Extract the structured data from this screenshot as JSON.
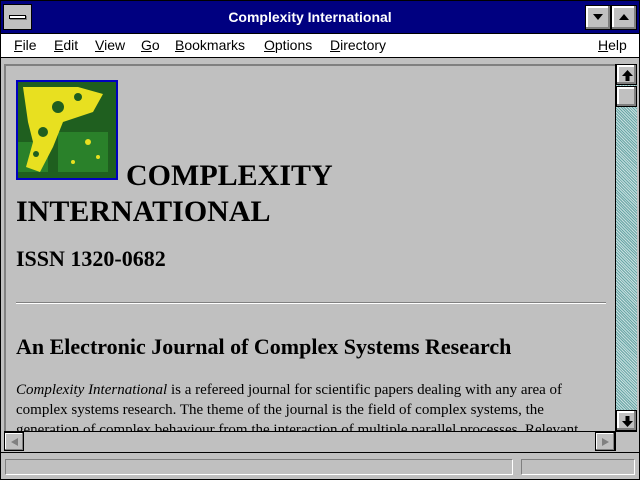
{
  "window": {
    "title": "Complexity International"
  },
  "menu": {
    "items": [
      {
        "label": "File",
        "underline": "F"
      },
      {
        "label": "Edit",
        "underline": "E"
      },
      {
        "label": "View",
        "underline": "V"
      },
      {
        "label": "Go",
        "underline": "G"
      },
      {
        "label": "Bookmarks",
        "underline": "B"
      },
      {
        "label": "Options",
        "underline": "O"
      },
      {
        "label": "Directory",
        "underline": "D"
      },
      {
        "label": "Help",
        "underline": "H"
      }
    ]
  },
  "page": {
    "title_line1": "COMPLEXITY",
    "title_line2": "INTERNATIONAL",
    "issn": "ISSN 1320-0682",
    "subtitle": "An Electronic Journal of Complex Systems Research",
    "para_italic": "Complexity International",
    "para_rest": " is a refereed journal for scientific papers dealing with any area of complex systems research. The theme of the journal is the field of complex systems, the generation of complex behaviour from the interaction of multiple parallel processes. Relevant topics include"
  },
  "icons": {
    "system_menu": "system-menu-icon",
    "minimize": "minimize-icon",
    "maximize": "maximize-icon",
    "scroll_up": "arrow-up-icon",
    "scroll_down": "arrow-down-icon",
    "scroll_left": "arrow-left-icon",
    "scroll_right": "arrow-right-icon",
    "logo": "journal-logo"
  },
  "status": {
    "text": "",
    "progress": 0
  },
  "colors": {
    "titlebar": "#000080",
    "page_bg": "#c0c0c0",
    "logo_border": "#0000c0"
  }
}
